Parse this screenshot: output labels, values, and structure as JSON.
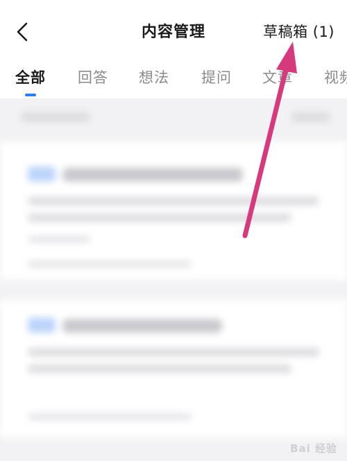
{
  "header": {
    "title": "内容管理",
    "drafts_label": "草稿箱 (1)"
  },
  "tabs": [
    {
      "label": "全部"
    },
    {
      "label": "回答"
    },
    {
      "label": "想法"
    },
    {
      "label": "提问"
    },
    {
      "label": "文章"
    },
    {
      "label": "视频"
    }
  ],
  "watermark": "Bai 经验",
  "colors": {
    "accent": "#2f7df6",
    "arrow": "#d63a7c"
  }
}
